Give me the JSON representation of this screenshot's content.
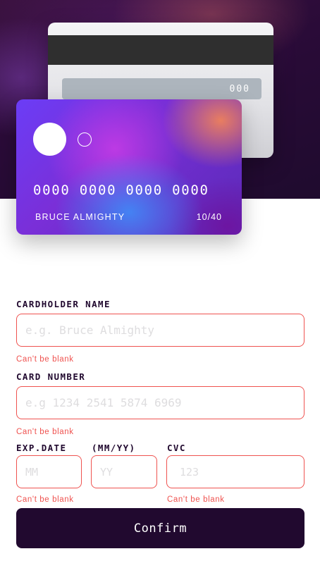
{
  "card_back": {
    "cvc": "000"
  },
  "card_front": {
    "number": "0000 0000 0000 0000",
    "name": "BRUCE ALMIGHTY",
    "expiry": "10/40"
  },
  "form": {
    "cardholder": {
      "label": "CARDHOLDER NAME",
      "placeholder": "e.g. Bruce Almighty",
      "value": "",
      "error": "Can't be blank"
    },
    "card_number": {
      "label": "CARD NUMBER",
      "placeholder": "e.g 1234 2541 5874 6969",
      "value": "",
      "error": "Can't be blank"
    },
    "exp_date": {
      "label": "EXP.DATE",
      "label_format": "(MM/YY)",
      "month_placeholder": "MM",
      "year_placeholder": "YY",
      "error": "Can't be blank"
    },
    "cvc": {
      "label": "CVC",
      "placeholder": "123",
      "error": "Can't be blank"
    }
  },
  "confirm_label": "Confirm",
  "colors": {
    "dark_violet": "#21092f",
    "error_red": "#ef5350",
    "placeholder_gray": "#dedddf"
  }
}
